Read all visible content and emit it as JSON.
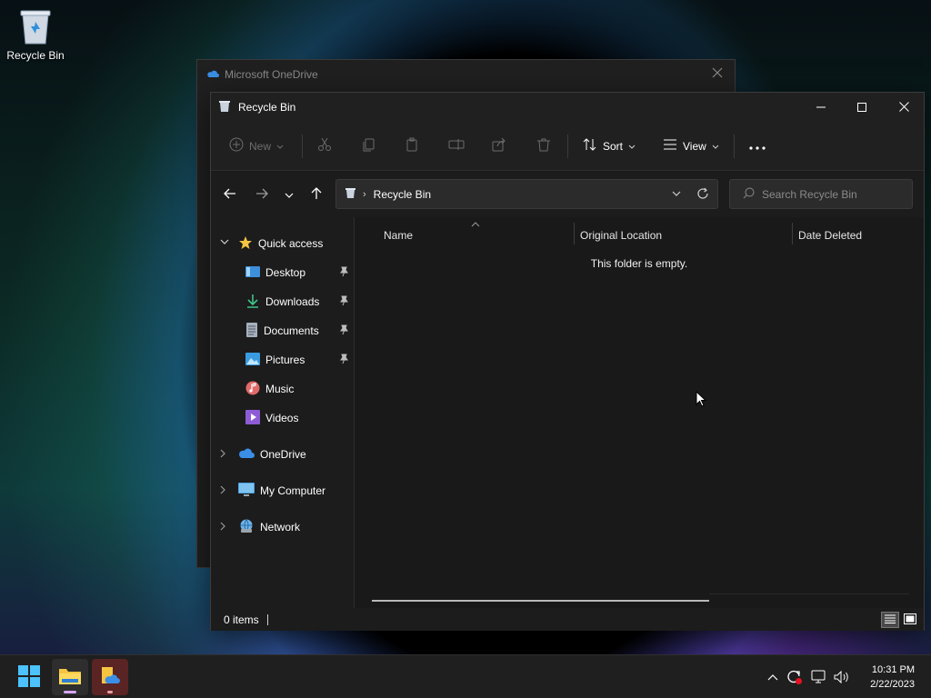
{
  "desktop": {
    "recycle_bin_label": "Recycle Bin"
  },
  "onedrive_window": {
    "title": "Microsoft OneDrive"
  },
  "explorer": {
    "title": "Recycle Bin",
    "toolbar": {
      "new_label": "New",
      "sort_label": "Sort",
      "view_label": "View"
    },
    "address": {
      "path": "Recycle Bin"
    },
    "search": {
      "placeholder": "Search Recycle Bin"
    },
    "sidebar": {
      "quick_access": "Quick access",
      "items": [
        {
          "label": "Desktop",
          "pinned": true
        },
        {
          "label": "Downloads",
          "pinned": true
        },
        {
          "label": "Documents",
          "pinned": true
        },
        {
          "label": "Pictures",
          "pinned": true
        },
        {
          "label": "Music",
          "pinned": false
        },
        {
          "label": "Videos",
          "pinned": false
        }
      ],
      "onedrive": "OneDrive",
      "my_computer": "My Computer",
      "network": "Network"
    },
    "columns": [
      "Name",
      "Original Location",
      "Date Deleted"
    ],
    "empty_message": "This folder is empty.",
    "status": {
      "item_count": "0 items"
    }
  },
  "taskbar": {
    "time": "10:31 PM",
    "date": "2/22/2023"
  },
  "colors": {
    "accent": "#4cc2ff",
    "folder_yellow": "#f5c542",
    "window_bg": "#191919",
    "titlebar_bg": "#202020"
  }
}
